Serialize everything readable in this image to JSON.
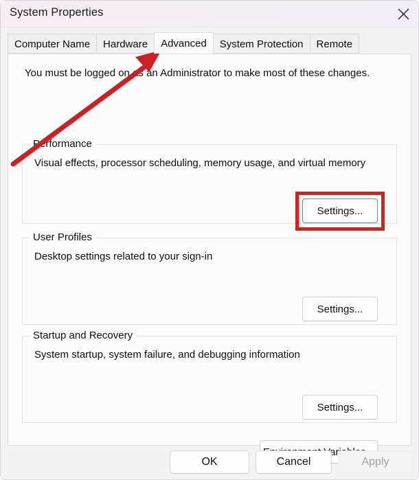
{
  "window": {
    "title": "System Properties",
    "close_icon": "close-icon"
  },
  "tabs": [
    {
      "label": "Computer Name",
      "selected": false
    },
    {
      "label": "Hardware",
      "selected": false
    },
    {
      "label": "Advanced",
      "selected": true
    },
    {
      "label": "System Protection",
      "selected": false
    },
    {
      "label": "Remote",
      "selected": false
    }
  ],
  "content": {
    "admin_note": "You must be logged on as an Administrator to make most of these changes.",
    "groups": [
      {
        "label": "Performance",
        "description": "Visual effects, processor scheduling, memory usage, and virtual memory",
        "button_label": "Settings..."
      },
      {
        "label": "User Profiles",
        "description": "Desktop settings related to your sign-in",
        "button_label": "Settings..."
      },
      {
        "label": "Startup and Recovery",
        "description": "System startup, system failure, and debugging information",
        "button_label": "Settings..."
      }
    ],
    "environment_variables_label": "Environment Variables..."
  },
  "footer": {
    "ok_label": "OK",
    "cancel_label": "Cancel",
    "apply_label": "Apply",
    "apply_enabled": false
  },
  "annotations": {
    "highlight_color": "#e01b1b",
    "arrow_color": "#cc2026",
    "arrow_target": "Advanced tab",
    "highlight_target": "Performance Settings... button"
  }
}
